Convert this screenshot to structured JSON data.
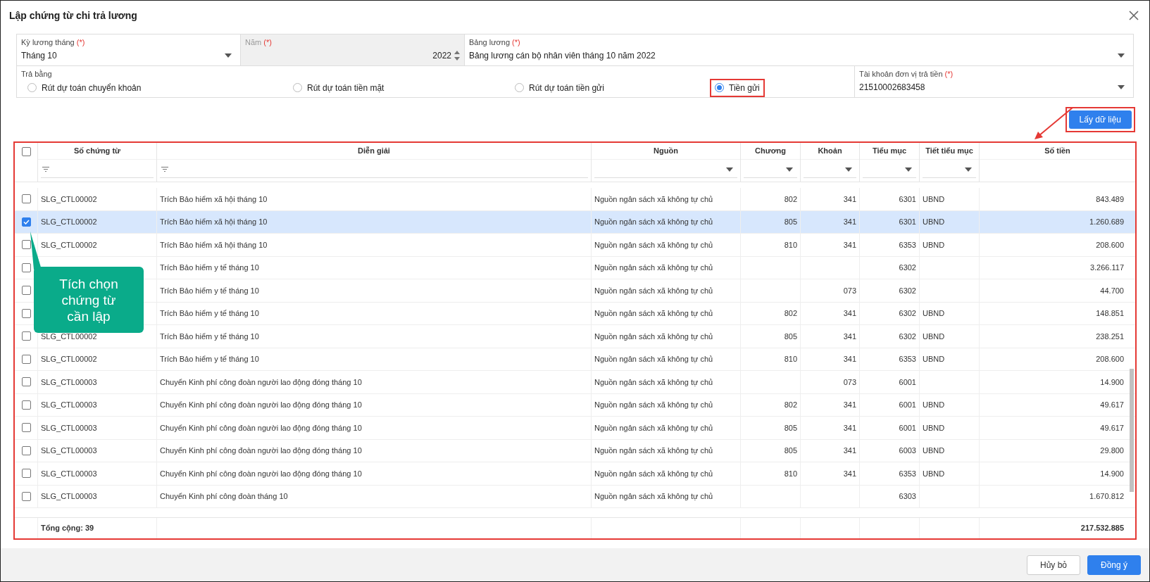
{
  "window": {
    "title": "Lập chứng từ chi trả lương"
  },
  "form": {
    "fields": [
      {
        "label": "Kỳ lương tháng",
        "required_mark": "(*)",
        "value": "Tháng 10",
        "kind": "dropdown",
        "disabled": false
      },
      {
        "label": "Năm",
        "required_mark": "(*)",
        "value": "2022",
        "kind": "spinner",
        "disabled": true
      },
      {
        "label": "Bảng lương",
        "required_mark": "(*)",
        "value": "Bảng lương cán bộ nhân viên tháng 10 năm 2022",
        "kind": "dropdown",
        "disabled": false
      }
    ],
    "payment": {
      "label": "Trả bằng",
      "options": [
        {
          "label": "Rút dự toán chuyển khoản",
          "selected": false
        },
        {
          "label": "Rút dự toán tiền mặt",
          "selected": false
        },
        {
          "label": "Rút dự toán tiền gửi",
          "selected": false
        },
        {
          "label": "Tiền gửi",
          "selected": true
        }
      ]
    },
    "account": {
      "label": "Tài khoản đơn vị trả tiền",
      "required_mark": "(*)",
      "value": "21510002683458",
      "kind": "dropdown",
      "disabled": false
    }
  },
  "fetch_button": "Lấy dữ liệu",
  "table": {
    "all_checked": false,
    "columns": [
      {
        "label": "Số chứng từ",
        "kind": "textfilter"
      },
      {
        "label": "Diễn giải",
        "kind": "textfilter"
      },
      {
        "label": "Nguồn",
        "kind": "selectfilter"
      },
      {
        "label": "Chương",
        "kind": "selectfilter"
      },
      {
        "label": "Khoản",
        "kind": "selectfilter"
      },
      {
        "label": "Tiểu mục",
        "kind": "selectfilter"
      },
      {
        "label": "Tiết tiểu mục",
        "kind": "selectfilter"
      },
      {
        "label": "Số tiền",
        "kind": "plain"
      }
    ],
    "rows": [
      {
        "selected": false,
        "cells": [
          "SLG_CTL00002",
          "Trích Bảo hiểm xã hội tháng 10",
          "Nguồn ngân sách xã không tự chủ",
          "802",
          "341",
          "6301",
          "UBND",
          "843.489"
        ]
      },
      {
        "selected": true,
        "cells": [
          "SLG_CTL00002",
          "Trích Bảo hiểm xã hội tháng 10",
          "Nguồn ngân sách xã không tự chủ",
          "805",
          "341",
          "6301",
          "UBND",
          "1.260.689"
        ]
      },
      {
        "selected": false,
        "cells": [
          "SLG_CTL00002",
          "Trích Bảo hiểm xã hội tháng 10",
          "Nguồn ngân sách xã không tự chủ",
          "810",
          "341",
          "6353",
          "UBND",
          "208.600"
        ]
      },
      {
        "selected": false,
        "cells": [
          null,
          "Trích Bảo hiểm y tế tháng 10",
          "Nguồn ngân sách xã không tự chủ",
          null,
          null,
          "6302",
          null,
          "3.266.117"
        ]
      },
      {
        "selected": false,
        "cells": [
          null,
          "Trích Bảo hiểm y tế tháng 10",
          "Nguồn ngân sách xã không tự chủ",
          null,
          "073",
          "6302",
          null,
          "44.700"
        ]
      },
      {
        "selected": false,
        "cells": [
          null,
          "Trích Bảo hiểm y tế tháng 10",
          "Nguồn ngân sách xã không tự chủ",
          "802",
          "341",
          "6302",
          "UBND",
          "148.851"
        ]
      },
      {
        "selected": false,
        "cells": [
          "SLG_CTL00002",
          "Trích Bảo hiểm y tế tháng 10",
          "Nguồn ngân sách xã không tự chủ",
          "805",
          "341",
          "6302",
          "UBND",
          "238.251"
        ]
      },
      {
        "selected": false,
        "cells": [
          "SLG_CTL00002",
          "Trích Bảo hiểm y tế tháng 10",
          "Nguồn ngân sách xã không tự chủ",
          "810",
          "341",
          "6353",
          "UBND",
          "208.600"
        ]
      },
      {
        "selected": false,
        "cells": [
          "SLG_CTL00003",
          "Chuyển Kinh phí công đoàn người lao động đóng tháng 10",
          "Nguồn ngân sách xã không tự chủ",
          null,
          "073",
          "6001",
          null,
          "14.900"
        ]
      },
      {
        "selected": false,
        "cells": [
          "SLG_CTL00003",
          "Chuyển Kinh phí công đoàn người lao động đóng tháng 10",
          "Nguồn ngân sách xã không tự chủ",
          "802",
          "341",
          "6001",
          "UBND",
          "49.617"
        ]
      },
      {
        "selected": false,
        "cells": [
          "SLG_CTL00003",
          "Chuyển Kinh phí công đoàn người lao động đóng tháng 10",
          "Nguồn ngân sách xã không tự chủ",
          "805",
          "341",
          "6001",
          "UBND",
          "49.617"
        ]
      },
      {
        "selected": false,
        "cells": [
          "SLG_CTL00003",
          "Chuyển Kinh phí công đoàn người lao động đóng tháng 10",
          "Nguồn ngân sách xã không tự chủ",
          "805",
          "341",
          "6003",
          "UBND",
          "29.800"
        ]
      },
      {
        "selected": false,
        "cells": [
          "SLG_CTL00003",
          "Chuyển Kinh phí công đoàn người lao động đóng tháng 10",
          "Nguồn ngân sách xã không tự chủ",
          "810",
          "341",
          "6353",
          "UBND",
          "14.900"
        ]
      },
      {
        "selected": false,
        "cells": [
          "SLG_CTL00003",
          "Chuyển Kinh phí công đoàn tháng 10",
          "Nguồn ngân sách xã không tự chủ",
          null,
          null,
          "6303",
          null,
          "1.670.812"
        ]
      }
    ],
    "footer": {
      "total_label": "Tổng cộng: 39",
      "total_amount": "217.532.885"
    }
  },
  "callout": {
    "text": "Tích chọn chứng từ cần lập"
  },
  "buttons": [
    {
      "label": "Hủy bỏ",
      "kind": "secondary"
    },
    {
      "label": "Đồng ý",
      "kind": "primary"
    }
  ]
}
